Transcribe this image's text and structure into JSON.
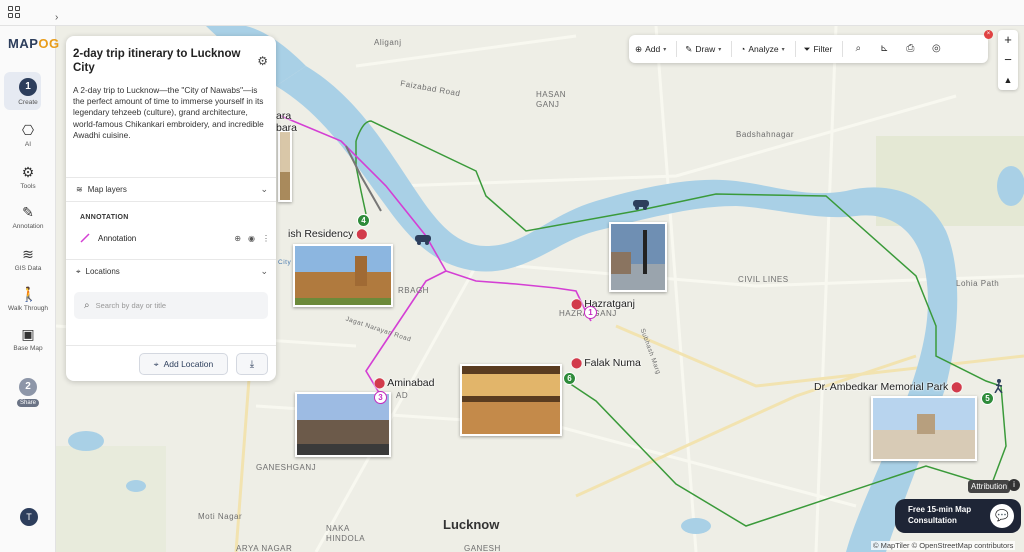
{
  "app": {
    "logo_prefix": "MAP",
    "logo_accent": "OG",
    "collapse_glyph": "›"
  },
  "rail": {
    "items": [
      {
        "label": "Create",
        "step": "1"
      },
      {
        "label": "AI"
      },
      {
        "label": "Tools"
      },
      {
        "label": "Annotation"
      },
      {
        "label": "GIS Data"
      },
      {
        "label": "Walk Through"
      },
      {
        "label": "Base Map"
      },
      {
        "label": "Share",
        "step": "2"
      }
    ],
    "avatar": "T"
  },
  "panel": {
    "title": "2-day trip itinerary to Lucknow City",
    "description": "A 2-day trip to Lucknow—the \"City of Nawabs\"—is the perfect amount of time to immerse yourself in its legendary tehzeeb (culture), grand architecture, world-famous Chikankari embroidery, and incredible Awadhi cuisine.",
    "map_layers_label": "Map layers",
    "annotation_heading": "ANNOTATION",
    "annotation_item": "Annotation",
    "locations_label": "Locations",
    "search_placeholder": "Search by day or title",
    "add_location_label": "Add Location"
  },
  "toolbar": {
    "add": "Add",
    "draw": "Draw",
    "analyze": "Analyze",
    "filter": "Filter"
  },
  "map": {
    "labels": {
      "aliganj": "Aliganj",
      "faizabad_road": "Faizabad Road",
      "hasanganj": "HASAN\nGANJ",
      "badshahnagar": "Badshahnagar",
      "civil_lines": "CIVIL LINES",
      "lohia_path": "Lohia Path",
      "charbagh": "RBAGH",
      "hazratganj_area": "HAZRATGANJ",
      "ganeshganj": "GANESHGANJ",
      "moti_nagar": "Moti Nagar",
      "naka_hindola": "NAKA\nHINDOLA",
      "ganesh": "GANESH",
      "arya_nagar": "ARYA NAGAR",
      "lucknow": "Lucknow",
      "jagat_narayan_road": "Jagat Narayan Road",
      "subhash_marg": "Subhash Marg",
      "city_station": "City Station",
      "ad": "AD"
    },
    "pois": {
      "residency": "ish Residency",
      "hazratganj": "Hazratganj",
      "falak_numa": "Falak Numa",
      "aminabad": "Aminabad",
      "ambedkar": "Dr. Ambedkar Memorial Park",
      "bara": "ara",
      "bara2": "bara"
    },
    "markers": {
      "m4": "4",
      "m1": "1",
      "m3": "3",
      "m6": "6",
      "m5": "5"
    },
    "route_colors": {
      "green": "#3a9a3a",
      "pink": "#d43fd4"
    }
  },
  "overlay": {
    "attribution": "Attribution",
    "info_glyph": "i",
    "consult_text": "Free 15-min Map Consultation",
    "footer_attr": "© MapTiler © OpenStreetMap contributors"
  }
}
